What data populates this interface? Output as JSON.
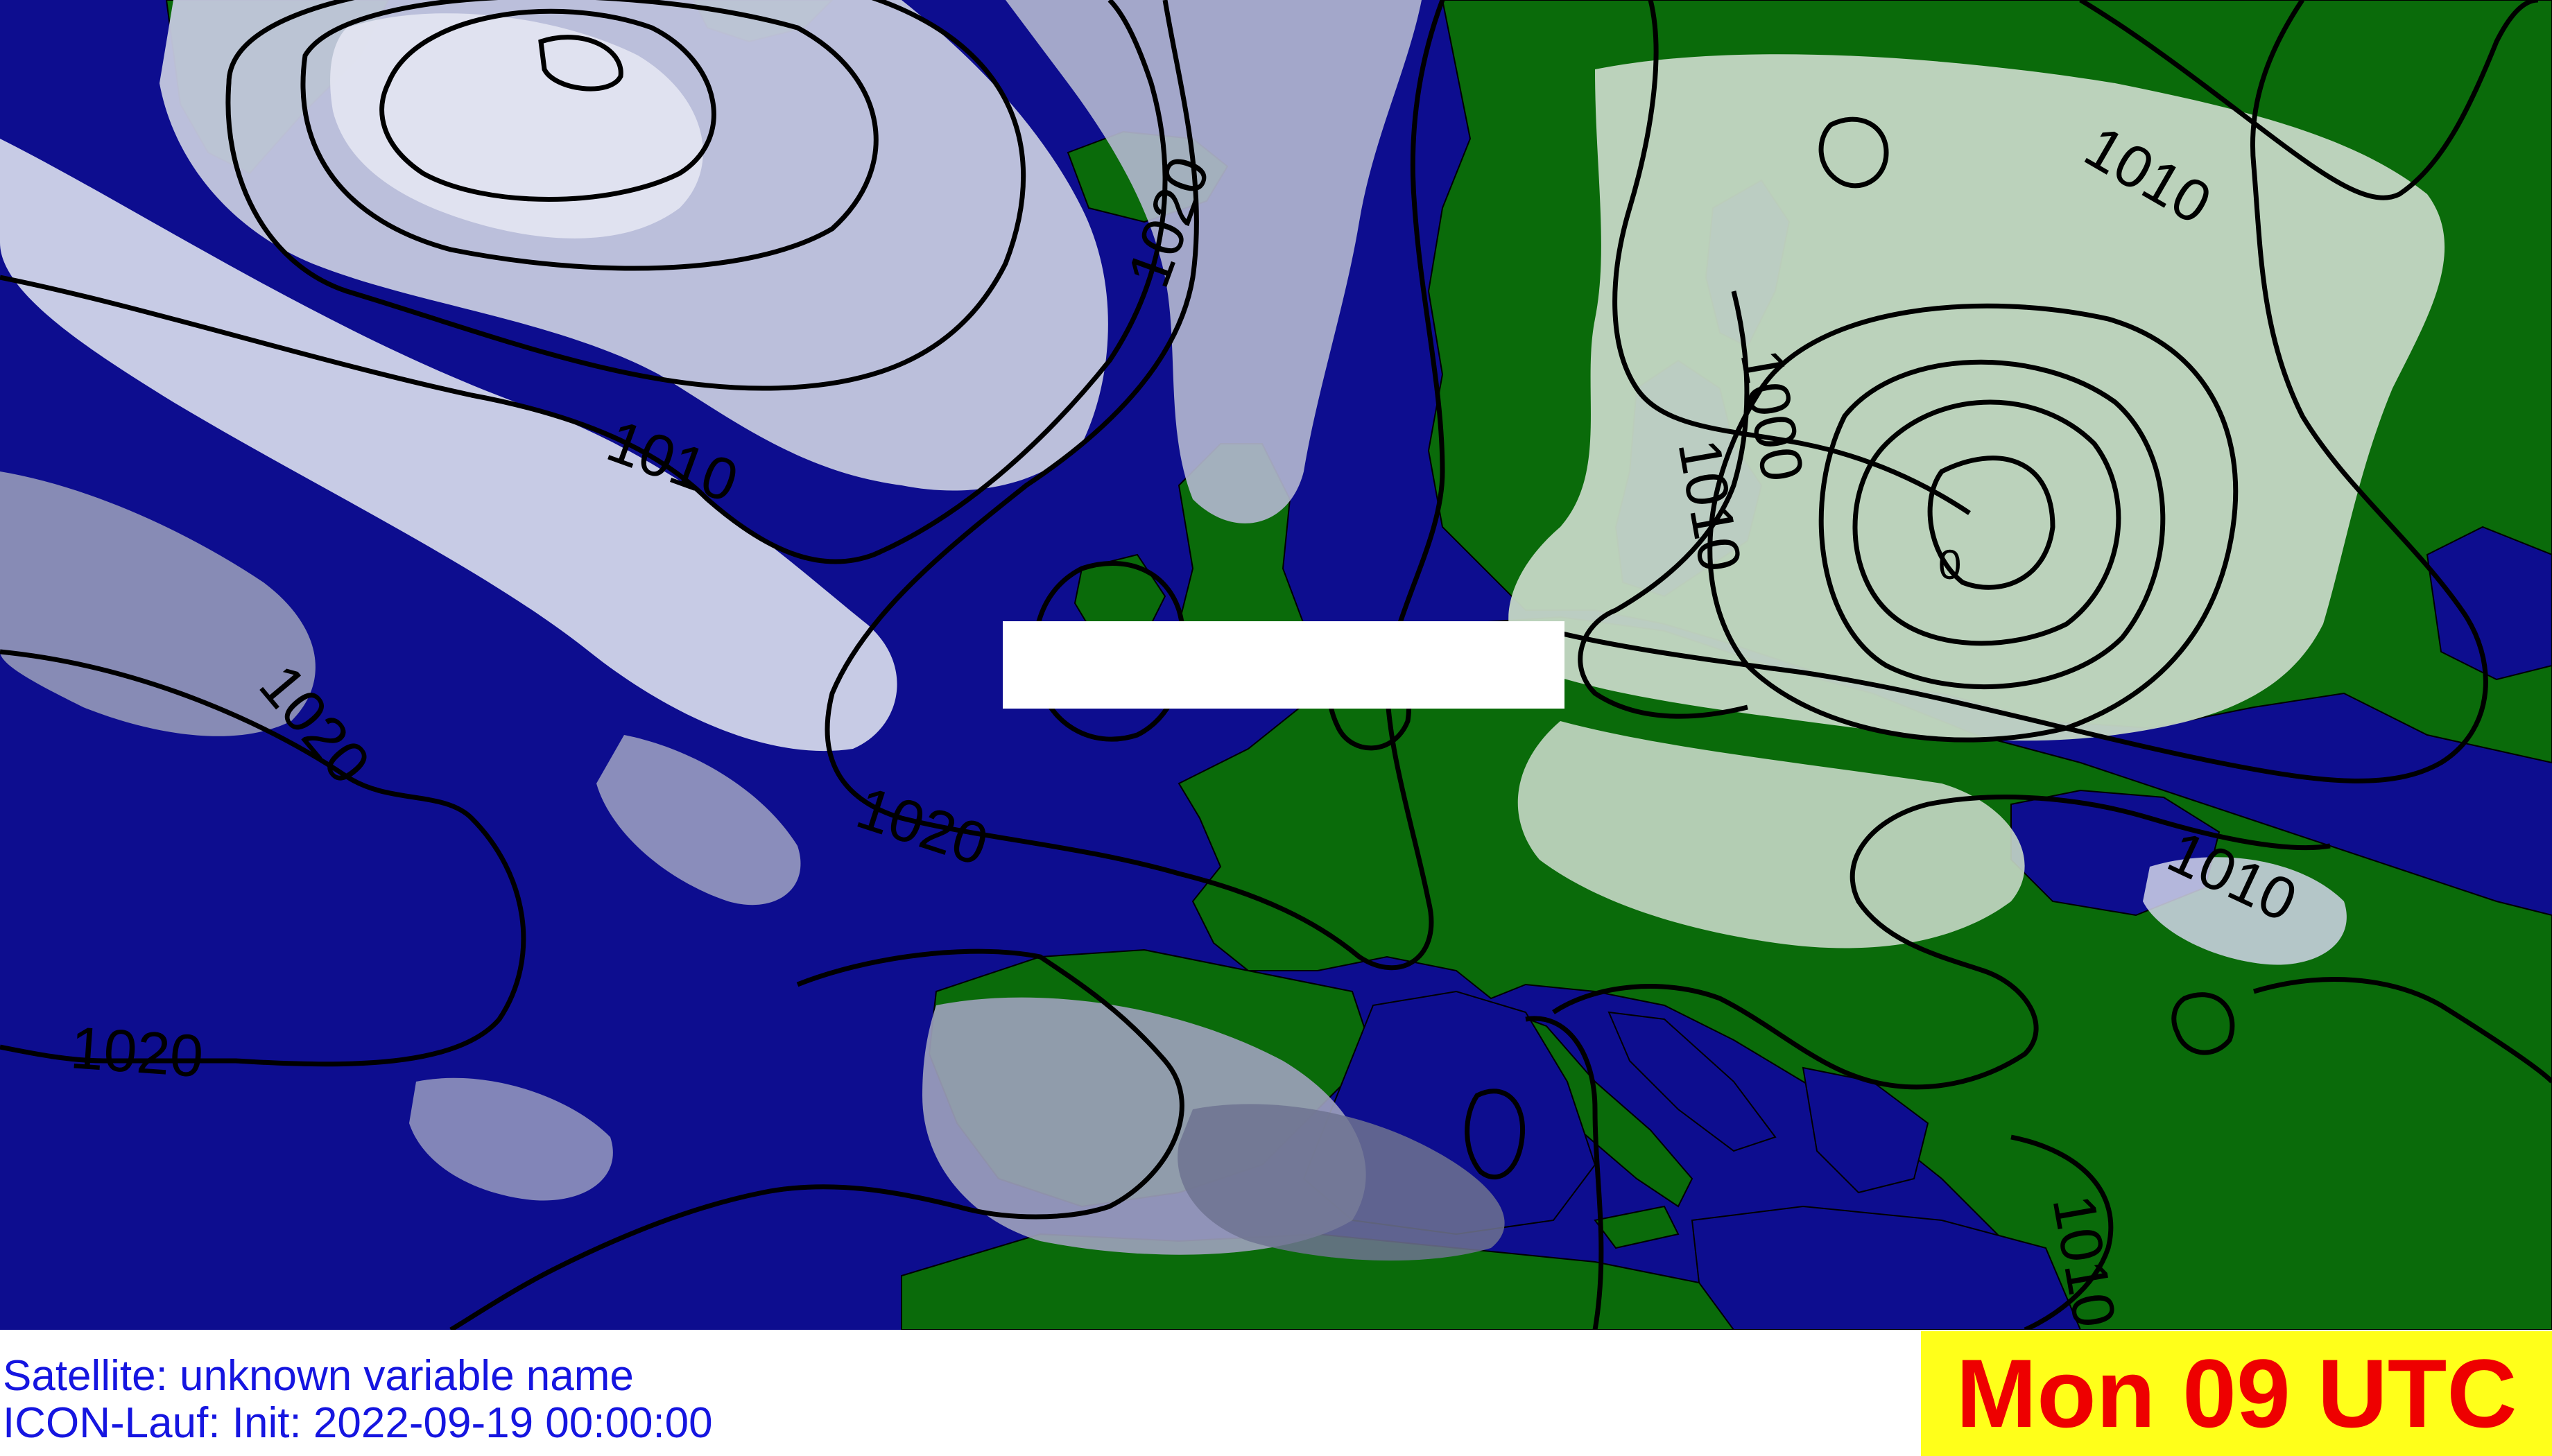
{
  "map": {
    "isobar_labels": [
      "1010",
      "1020",
      "1010",
      "1020",
      "1020",
      "1020",
      "1010",
      "1000",
      "0",
      "1010",
      "1010"
    ],
    "colors": {
      "ocean": "#0d0d8f",
      "land": "#0a6b0a",
      "cloud_high": "#d2d6ea",
      "cloud_mid": "#aaaec6",
      "cloud_low": "#7c8099",
      "cloud_land": "#c5d8c5",
      "isobar": "#000000",
      "redacted_box": "#ffffff"
    }
  },
  "footer": {
    "satellite_caption": "Satellite: unknown variable name",
    "run_caption": "ICON-Lauf: Init: 2022-09-19 00:00:00"
  },
  "time_badge": {
    "label": "Mon 09 UTC",
    "background": "#ffff1a",
    "text_color": "#ee0000"
  }
}
